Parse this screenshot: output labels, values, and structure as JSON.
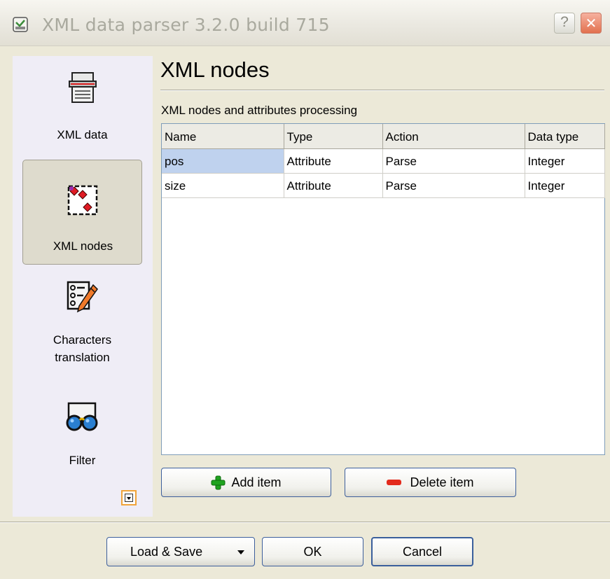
{
  "window": {
    "title": "XML data parser 3.2.0 build 715",
    "help_glyph": "?",
    "close_glyph": "✕"
  },
  "sidebar": {
    "items": [
      {
        "label": "XML data",
        "icon": "printer-icon",
        "selected": false
      },
      {
        "label": "XML nodes",
        "icon": "nodes-icon",
        "selected": true
      },
      {
        "label": "Characters translation",
        "icon": "translation-icon",
        "selected": false
      },
      {
        "label": "Filter",
        "icon": "filter-glasses-icon",
        "selected": false
      }
    ]
  },
  "main": {
    "title": "XML nodes",
    "section_label": "XML nodes and attributes processing",
    "table": {
      "columns": [
        "Name",
        "Type",
        "Action",
        "Data type"
      ],
      "rows": [
        [
          "pos",
          "Attribute",
          "Parse",
          "Integer"
        ],
        [
          "size",
          "Attribute",
          "Parse",
          "Integer"
        ]
      ]
    },
    "add_button": "Add item",
    "delete_button": "Delete item"
  },
  "footer": {
    "load_save": "Load & Save",
    "ok": "OK",
    "cancel": "Cancel"
  },
  "colors": {
    "selected_cell": "#bfd2ee",
    "add_icon": "#1fa31f",
    "delete_icon": "#e32a1c"
  }
}
